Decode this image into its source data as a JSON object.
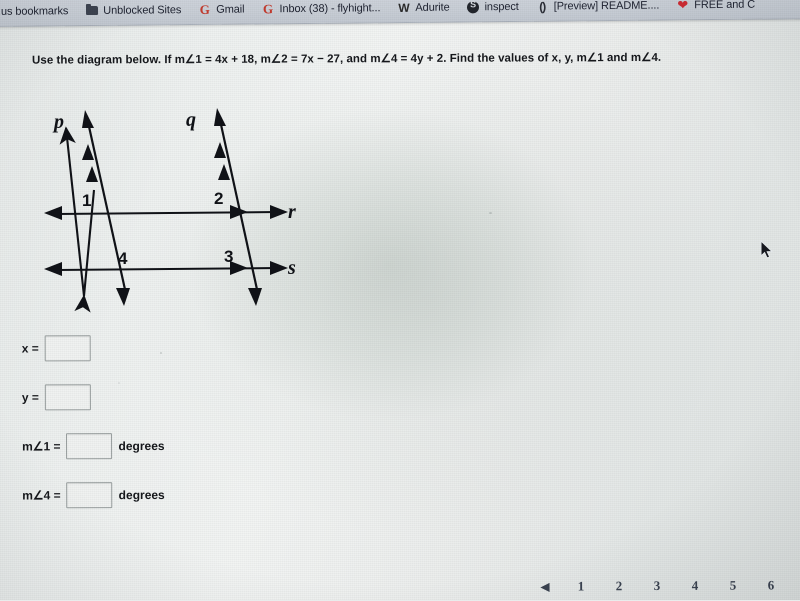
{
  "browser": {
    "bookmarks_bar": {
      "items": [
        {
          "icon": "text-only",
          "label": ".us bookmarks"
        },
        {
          "icon": "folder-icon",
          "label": "Unblocked Sites"
        },
        {
          "icon": "google-g-icon",
          "label": "Gmail"
        },
        {
          "icon": "google-g-icon",
          "label": "Inbox (38) - flyhight..."
        },
        {
          "icon": "w-icon",
          "label": "Adurite"
        },
        {
          "icon": "s-circle-icon",
          "label": "inspect"
        },
        {
          "icon": "paren-icon",
          "label": "[Preview] README...."
        },
        {
          "icon": "heart-icon",
          "label": "FREE and C"
        }
      ]
    }
  },
  "question": {
    "text": "Use the diagram below. If m∠1 = 4x + 18, m∠2 = 7x − 27, and m∠4 = 4y + 2.  Find the values of x, y, m∠1 and m∠4."
  },
  "figure": {
    "caption": "Two parallel transversals p and q crossing two parallel lines r and s",
    "line_labels": {
      "p": "p",
      "q": "q",
      "r": "r",
      "s": "s"
    },
    "angle_labels": {
      "one": "1",
      "two": "2",
      "three": "3",
      "four": "4"
    }
  },
  "answers": {
    "rows": [
      {
        "label": "x =",
        "value": "",
        "unit": ""
      },
      {
        "label": "y =",
        "value": "",
        "unit": ""
      },
      {
        "label": "m∠1 =",
        "value": "",
        "unit": "degrees"
      },
      {
        "label": "m∠4 =",
        "value": "",
        "unit": "degrees"
      }
    ]
  },
  "pagination": {
    "prev_icon": "◀",
    "pages": [
      "1",
      "2",
      "3",
      "4",
      "5",
      "6"
    ]
  },
  "colors": {
    "page_background": "#eef1f0",
    "bookmark_bar": "#c9cfd7",
    "text": "#16181c",
    "gmail_red": "#c33b2e",
    "heart_red": "#cf2b33",
    "field_border": "#9aa0a0"
  }
}
